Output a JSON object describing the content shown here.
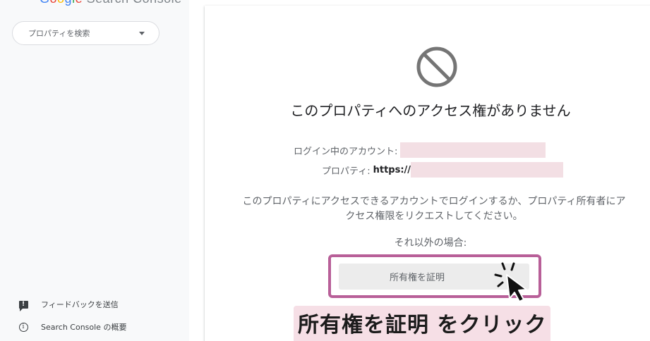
{
  "app": {
    "logo": {
      "letters": [
        "G",
        "o",
        "o",
        "g",
        "l",
        "e"
      ],
      "product": " Search Console"
    }
  },
  "sidebar": {
    "search": {
      "placeholder": "プロパティを検索"
    },
    "links": [
      {
        "label": "フィードバックを送信",
        "icon": "feedback-icon"
      },
      {
        "label": "Search Console の概要",
        "icon": "info-icon"
      }
    ]
  },
  "main": {
    "title": "このプロパティへのアクセス権がありません",
    "account_label": "ログイン中のアカウント:",
    "property_label": "プロパティ:",
    "property_value": "https://",
    "description": "このプロパティにアクセスできるアカウントでログインするか、プロパティ所有者にアクセス権限をリクエストしてください。",
    "otherwise": "それ以外の場合:",
    "verify_button": "所有権を証明"
  },
  "annotation": {
    "caption": "所有権を証明 をクリック",
    "highlight_color": "#b85f98",
    "caption_bg": "#f6dfe6"
  },
  "colors": {
    "redaction": "#f3dfe4",
    "sidebar_bg": "#f8f9fa",
    "button_bg": "#ececec"
  }
}
